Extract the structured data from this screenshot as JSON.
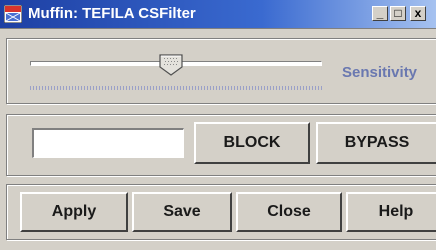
{
  "window": {
    "title": "Muffin: TEFILA CSFilter",
    "icon": "muffin-app-icon",
    "controls": {
      "minimize": "_",
      "maximize": "□",
      "close": "x"
    }
  },
  "sensitivity": {
    "label": "Sensitivity",
    "level": 0.48
  },
  "filter": {
    "input_value": "",
    "block_label": "BLOCK",
    "bypass_label": "BYPASS"
  },
  "actions": {
    "apply_label": "Apply",
    "save_label": "Save",
    "close_label": "Close",
    "help_label": "Help"
  },
  "colors": {
    "title_bar": "#1d3fa3",
    "window_bg": "#d4d0c8",
    "sensitivity_text": "#6a78b0"
  }
}
